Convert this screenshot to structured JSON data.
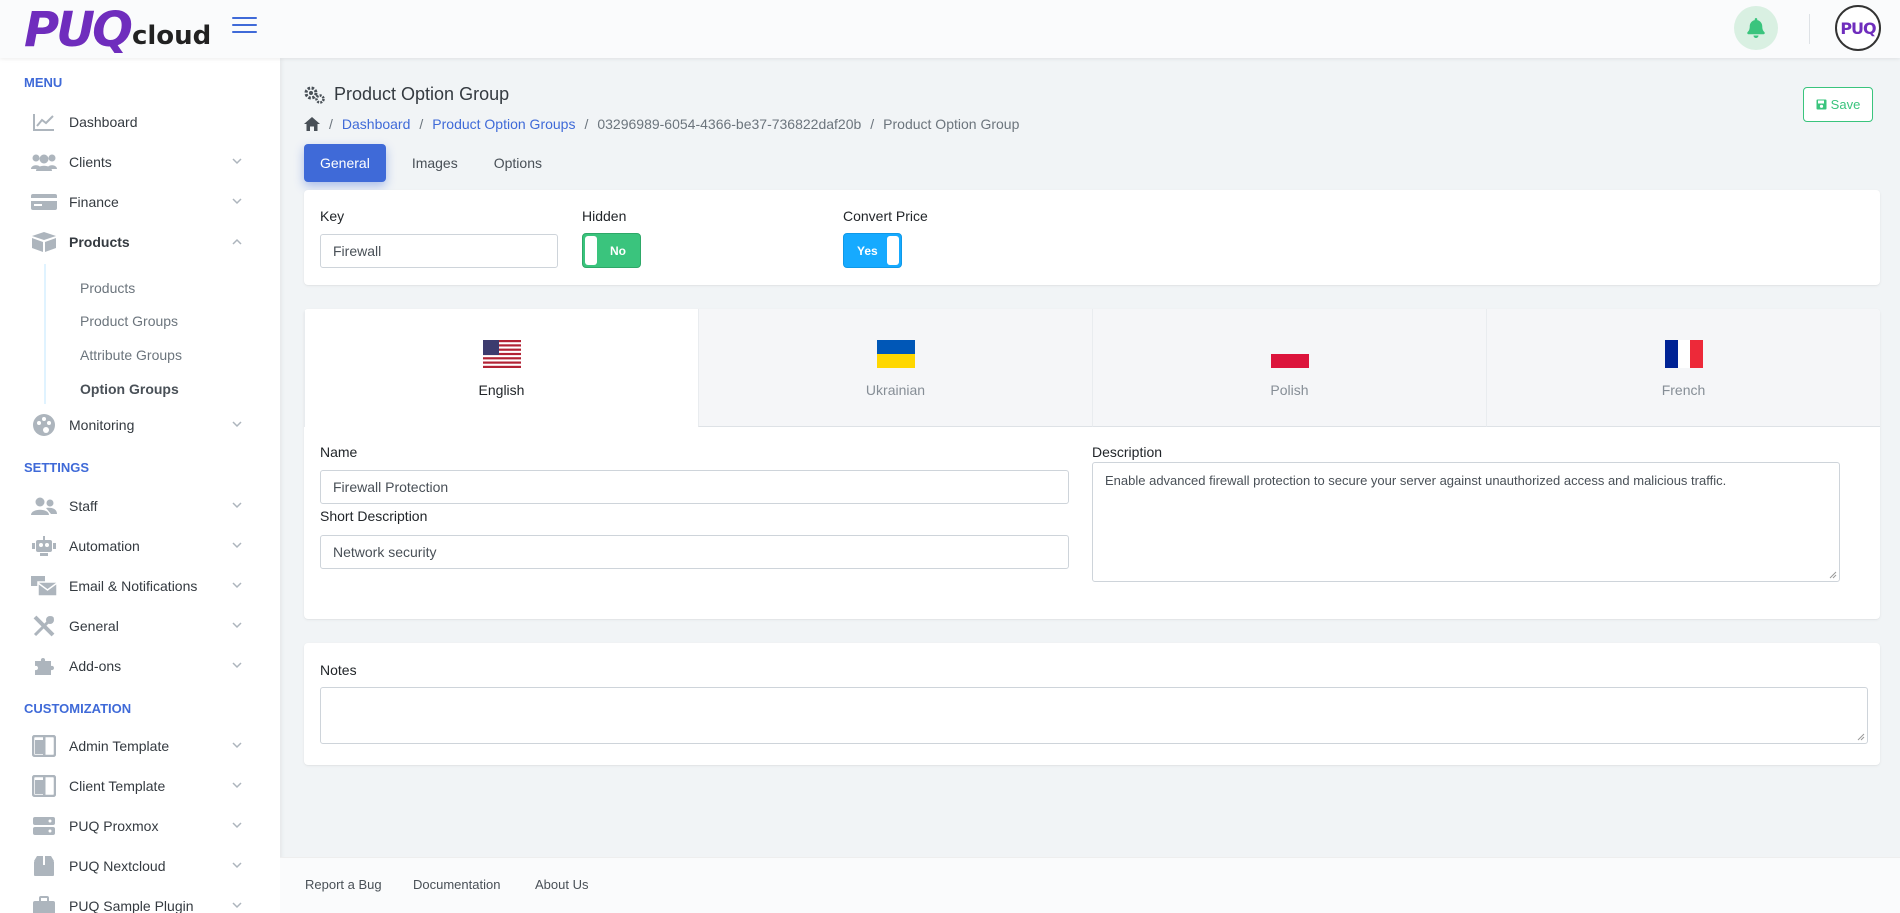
{
  "header": {
    "logo_main": "PUQ",
    "logo_sub": "cloud",
    "avatar_text": "PUQ",
    "icons": {
      "menu": "hamburger-icon",
      "bell": "bell-icon"
    },
    "colors": {
      "brand": "#6f2dbd",
      "primary": "#3f6ad8",
      "success": "#3ac47d",
      "info": "#16aaff"
    }
  },
  "sidebar": {
    "sections": {
      "menu": "MENU",
      "settings": "SETTINGS",
      "customization": "CUSTOMIZATION"
    },
    "items": [
      {
        "label": "Dashboard",
        "icon": "chart-line-icon"
      },
      {
        "label": "Clients",
        "icon": "users-icon"
      },
      {
        "label": "Finance",
        "icon": "credit-card-icon"
      },
      {
        "label": "Products",
        "icon": "boxes-icon"
      },
      {
        "label": "Monitoring",
        "icon": "palette-icon"
      },
      {
        "label": "Staff",
        "icon": "user-friends-icon"
      },
      {
        "label": "Automation",
        "icon": "robot-icon"
      },
      {
        "label": "Email & Notifications",
        "icon": "mail-bulk-icon"
      },
      {
        "label": "General",
        "icon": "tools-icon"
      },
      {
        "label": "Add-ons",
        "icon": "puzzle-icon"
      },
      {
        "label": "Admin Template",
        "icon": "columns-icon"
      },
      {
        "label": "Client Template",
        "icon": "columns-icon"
      },
      {
        "label": "PUQ Proxmox",
        "icon": "server-icon"
      },
      {
        "label": "PUQ Nextcloud",
        "icon": "box-icon"
      },
      {
        "label": "PUQ Sample Plugin",
        "icon": "briefcase-icon"
      }
    ],
    "product_sub": [
      "Products",
      "Product Groups",
      "Attribute Groups",
      "Option Groups"
    ]
  },
  "page": {
    "title": "Product Option Group",
    "breadcrumb": [
      "Dashboard",
      "Product Option Groups",
      "03296989-6054-4366-be37-736822daf20b",
      "Product Option Group"
    ],
    "save_label": "Save",
    "tabs": [
      "General",
      "Images",
      "Options"
    ]
  },
  "general": {
    "key_label": "Key",
    "key_value": "Firewall",
    "hidden_label": "Hidden",
    "hidden_value": "No",
    "convert_label": "Convert Price",
    "convert_value": "Yes"
  },
  "languages": [
    "English",
    "Ukrainian",
    "Polish",
    "French"
  ],
  "translation": {
    "name_label": "Name",
    "name_value": "Firewall Protection",
    "short_label": "Short Description",
    "short_value": "Network security",
    "desc_label": "Description",
    "desc_value": "Enable advanced firewall protection to secure your server against unauthorized access and malicious traffic."
  },
  "notes": {
    "label": "Notes",
    "value": ""
  },
  "footer": {
    "links": [
      "Report a Bug",
      "Documentation",
      "About Us"
    ]
  }
}
